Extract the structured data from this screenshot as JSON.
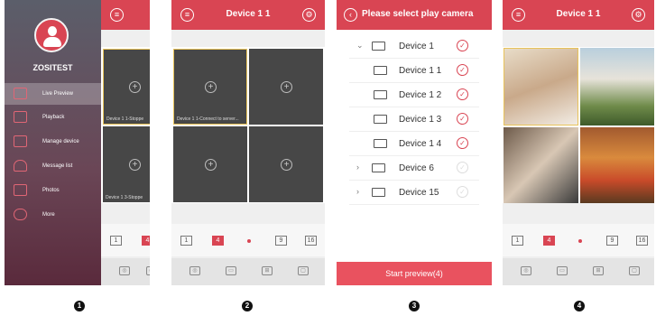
{
  "panel1": {
    "user": "ZOSITEST",
    "menu": [
      {
        "label": "Live Preview",
        "icon": "camera-icon"
      },
      {
        "label": "Playback",
        "icon": "playback-icon"
      },
      {
        "label": "Manage device",
        "icon": "device-icon"
      },
      {
        "label": "Message list",
        "icon": "bell-icon"
      },
      {
        "label": "Photos",
        "icon": "photo-icon"
      },
      {
        "label": "More",
        "icon": "cloud-icon"
      }
    ],
    "labels": [
      "Device 1 1-Stoppe",
      "Device 1 3-Stoppe"
    ],
    "layout": [
      "1",
      "4"
    ]
  },
  "panel2": {
    "title": "Device 1 1",
    "label": "Device 1 1-Connect to server...",
    "layout": [
      "1",
      "4",
      "9",
      "16"
    ]
  },
  "panel3": {
    "title": "Please select play camera",
    "rows": [
      {
        "name": "Device 1",
        "group": true,
        "expanded": true,
        "checked": true
      },
      {
        "name": "Device 1 1",
        "group": false,
        "checked": true
      },
      {
        "name": "Device 1 2",
        "group": false,
        "checked": true
      },
      {
        "name": "Device 1 3",
        "group": false,
        "checked": true
      },
      {
        "name": "Device 1 4",
        "group": false,
        "checked": true
      },
      {
        "name": "Device 6",
        "group": true,
        "expanded": false,
        "checked": false
      },
      {
        "name": "Device 15",
        "group": true,
        "expanded": false,
        "checked": false
      }
    ],
    "button": "Start preview(4)"
  },
  "panel4": {
    "title": "Device 1 1",
    "layout": [
      "1",
      "4",
      "9",
      "16"
    ]
  },
  "steps": [
    "1",
    "2",
    "3",
    "4"
  ],
  "colors": {
    "accent": "#d94553"
  }
}
